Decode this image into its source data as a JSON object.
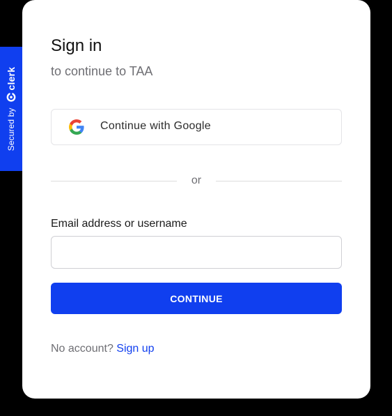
{
  "badge": {
    "secured_by": "Secured by",
    "brand": "clerk"
  },
  "card": {
    "title": "Sign in",
    "subtitle": "to continue to TAA"
  },
  "google": {
    "label": "Continue with Google"
  },
  "divider": {
    "text": "or"
  },
  "email": {
    "label": "Email address or username",
    "value": "",
    "placeholder": ""
  },
  "continue": {
    "label": "CONTINUE"
  },
  "footer": {
    "prompt": "No account?",
    "link": "Sign up"
  },
  "colors": {
    "accent": "#103fef",
    "background": "#000000",
    "card": "#ffffff"
  }
}
